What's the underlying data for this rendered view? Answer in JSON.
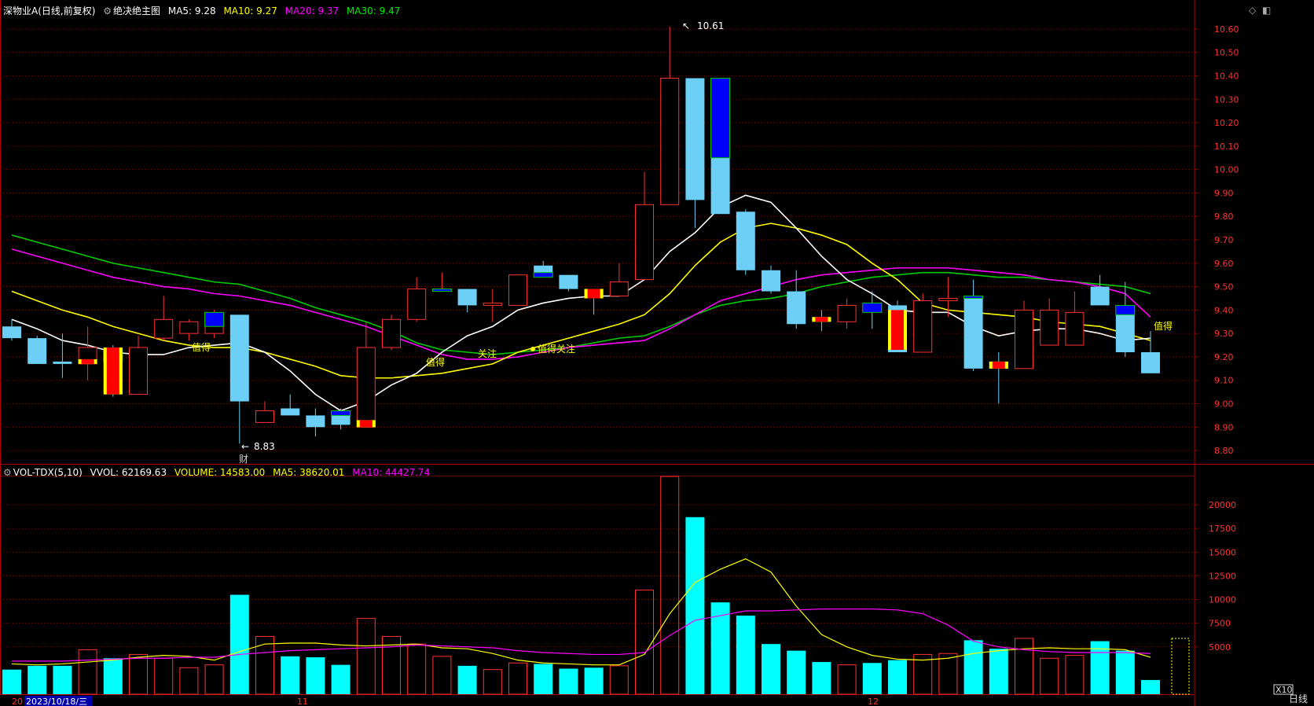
{
  "colors": {
    "up": "#ff3030",
    "down_fill": "#6ccff6",
    "vol_down": "#00ffff",
    "ma5": "#ffffff",
    "ma10": "#ffff00",
    "ma20": "#ff00ff",
    "ma30": "#00cc00",
    "grid": "#8b0000",
    "axis_text": "#ff3333",
    "blue_box": "#0000ff",
    "yellow": "#ffff00"
  },
  "main_header": {
    "stock": "深物业A",
    "mode": "(日线,前复权)",
    "indicator": "绝决绝主图",
    "ma5": "MA5: 9.28",
    "ma10": "MA10: 9.27",
    "ma20": "MA20: 9.37",
    "ma30": "MA30: 9.47"
  },
  "vol_header": {
    "name": "VOL-TDX(5,10)",
    "vvol": "VVOL: 62169.63",
    "volume": "VOLUME: 14583.00",
    "ma5": "MA5: 38620.01",
    "ma10": "MA10: 44427.74"
  },
  "price_axis": {
    "ticks": [
      "10.60",
      "10.50",
      "10.40",
      "10.30",
      "10.20",
      "10.10",
      "10.00",
      "9.90",
      "9.80",
      "9.70",
      "9.60",
      "9.50",
      "9.40",
      "9.30",
      "9.20",
      "9.10",
      "9.00",
      "8.90",
      "8.80"
    ]
  },
  "volume_axis": {
    "ticks": [
      "20000",
      "17500",
      "15000",
      "12500",
      "10000",
      "7500",
      "5000"
    ],
    "unit": "X10"
  },
  "date_axis": {
    "left_stub": "20",
    "selected": "2023/10/18/三",
    "month_labels": [
      "11",
      "12"
    ]
  },
  "annotations": {
    "high": "10.61",
    "low": "8.83",
    "cai": "财",
    "labels": [
      "值得",
      "值得",
      "关注",
      "值得关注",
      "值得"
    ]
  },
  "period": "日线",
  "chart_data": {
    "type": "candlestick",
    "ylim": [
      8.75,
      10.65
    ],
    "volume_ylim": [
      0,
      23000
    ],
    "candles": [
      {
        "o": 9.33,
        "h": 9.36,
        "l": 9.27,
        "c": 9.28,
        "v": 2600
      },
      {
        "o": 9.28,
        "h": 9.29,
        "l": 9.17,
        "c": 9.17,
        "v": 3000
      },
      {
        "o": 9.18,
        "h": 9.3,
        "l": 9.11,
        "c": 9.17,
        "v": 3000
      },
      {
        "o": 9.17,
        "h": 9.33,
        "l": 9.1,
        "c": 9.24,
        "v": 4700
      },
      {
        "o": 9.24,
        "h": 9.25,
        "l": 9.03,
        "c": 9.04,
        "v": 3800
      },
      {
        "o": 9.04,
        "h": 9.29,
        "l": 9.04,
        "c": 9.24,
        "v": 4200
      },
      {
        "o": 9.28,
        "h": 9.46,
        "l": 9.27,
        "c": 9.36,
        "v": 3800
      },
      {
        "o": 9.3,
        "h": 9.36,
        "l": 9.27,
        "c": 9.35,
        "v": 2800
      },
      {
        "o": 9.3,
        "h": 9.4,
        "l": 9.28,
        "c": 9.38,
        "v": 3100
      },
      {
        "o": 9.38,
        "h": 9.38,
        "l": 8.83,
        "c": 9.01,
        "v": 10500
      },
      {
        "o": 8.92,
        "h": 9.01,
        "l": 8.92,
        "c": 8.97,
        "v": 6100
      },
      {
        "o": 8.98,
        "h": 9.04,
        "l": 8.95,
        "c": 8.95,
        "v": 4000
      },
      {
        "o": 8.95,
        "h": 8.98,
        "l": 8.86,
        "c": 8.9,
        "v": 3900
      },
      {
        "o": 8.97,
        "h": 8.98,
        "l": 8.89,
        "c": 8.91,
        "v": 3100
      },
      {
        "o": 8.9,
        "h": 9.35,
        "l": 8.9,
        "c": 9.24,
        "v": 8000
      },
      {
        "o": 9.24,
        "h": 9.38,
        "l": 9.23,
        "c": 9.36,
        "v": 6100
      },
      {
        "o": 9.36,
        "h": 9.54,
        "l": 9.35,
        "c": 9.49,
        "v": 5300
      },
      {
        "o": 9.48,
        "h": 9.56,
        "l": 9.48,
        "c": 9.49,
        "v": 4000
      },
      {
        "o": 9.49,
        "h": 9.49,
        "l": 9.39,
        "c": 9.42,
        "v": 3000
      },
      {
        "o": 9.42,
        "h": 9.49,
        "l": 9.35,
        "c": 9.43,
        "v": 2600
      },
      {
        "o": 9.42,
        "h": 9.55,
        "l": 9.42,
        "c": 9.55,
        "v": 3300
      },
      {
        "o": 9.59,
        "h": 9.61,
        "l": 9.54,
        "c": 9.56,
        "v": 3200
      },
      {
        "o": 9.55,
        "h": 9.55,
        "l": 9.48,
        "c": 9.49,
        "v": 2700
      },
      {
        "o": 9.49,
        "h": 9.49,
        "l": 9.38,
        "c": 9.46,
        "v": 2800
      },
      {
        "o": 9.46,
        "h": 9.6,
        "l": 9.46,
        "c": 9.52,
        "v": 3000
      },
      {
        "o": 9.53,
        "h": 9.99,
        "l": 9.53,
        "c": 9.85,
        "v": 11000
      },
      {
        "o": 9.85,
        "h": 10.61,
        "l": 9.85,
        "c": 10.39,
        "v": 23000
      },
      {
        "o": 10.39,
        "h": 10.39,
        "l": 9.75,
        "c": 9.87,
        "v": 18700
      },
      {
        "o": 10.39,
        "h": 10.39,
        "l": 9.81,
        "c": 9.81,
        "v": 9700
      },
      {
        "o": 9.82,
        "h": 9.83,
        "l": 9.55,
        "c": 9.57,
        "v": 8300
      },
      {
        "o": 9.57,
        "h": 9.59,
        "l": 9.47,
        "c": 9.48,
        "v": 5300
      },
      {
        "o": 9.48,
        "h": 9.57,
        "l": 9.32,
        "c": 9.34,
        "v": 4600
      },
      {
        "o": 9.37,
        "h": 9.4,
        "l": 9.31,
        "c": 9.35,
        "v": 3400
      },
      {
        "o": 9.35,
        "h": 9.45,
        "l": 9.32,
        "c": 9.42,
        "v": 3100
      },
      {
        "o": 9.43,
        "h": 9.48,
        "l": 9.32,
        "c": 9.39,
        "v": 3300
      },
      {
        "o": 9.42,
        "h": 9.44,
        "l": 9.22,
        "c": 9.22,
        "v": 3600
      },
      {
        "o": 9.22,
        "h": 9.47,
        "l": 9.22,
        "c": 9.44,
        "v": 4200
      },
      {
        "o": 9.44,
        "h": 9.54,
        "l": 9.37,
        "c": 9.45,
        "v": 4300
      },
      {
        "o": 9.46,
        "h": 9.53,
        "l": 9.14,
        "c": 9.15,
        "v": 5700
      },
      {
        "o": 9.18,
        "h": 9.22,
        "l": 9.0,
        "c": 9.15,
        "v": 4800
      },
      {
        "o": 9.15,
        "h": 9.44,
        "l": 9.15,
        "c": 9.4,
        "v": 5900
      },
      {
        "o": 9.25,
        "h": 9.45,
        "l": 9.25,
        "c": 9.4,
        "v": 3800
      },
      {
        "o": 9.25,
        "h": 9.48,
        "l": 9.25,
        "c": 9.39,
        "v": 4100
      },
      {
        "o": 9.5,
        "h": 9.55,
        "l": 9.42,
        "c": 9.42,
        "v": 5600
      },
      {
        "o": 9.42,
        "h": 9.52,
        "l": 9.2,
        "c": 9.22,
        "v": 4600
      },
      {
        "o": 9.22,
        "h": 9.31,
        "l": 9.13,
        "c": 9.13,
        "v": 1500
      }
    ],
    "ma5": [
      9.36,
      9.32,
      9.27,
      9.25,
      9.22,
      9.21,
      9.21,
      9.24,
      9.25,
      9.26,
      9.22,
      9.14,
      9.04,
      8.97,
      9.01,
      9.08,
      9.13,
      9.22,
      9.29,
      9.33,
      9.4,
      9.43,
      9.45,
      9.46,
      9.46,
      9.53,
      9.65,
      9.73,
      9.84,
      9.89,
      9.86,
      9.75,
      9.63,
      9.53,
      9.47,
      9.4,
      9.39,
      9.39,
      9.33,
      9.29,
      9.31,
      9.32,
      9.32,
      9.3,
      9.27,
      9.28
    ],
    "ma10": [
      9.48,
      9.44,
      9.4,
      9.37,
      9.33,
      9.3,
      9.27,
      9.25,
      9.24,
      9.24,
      9.22,
      9.19,
      9.16,
      9.12,
      9.11,
      9.11,
      9.12,
      9.13,
      9.15,
      9.17,
      9.22,
      9.25,
      9.28,
      9.31,
      9.34,
      9.38,
      9.47,
      9.59,
      9.69,
      9.75,
      9.77,
      9.75,
      9.72,
      9.68,
      9.6,
      9.53,
      9.43,
      9.4,
      9.39,
      9.38,
      9.37,
      9.35,
      9.34,
      9.33,
      9.3,
      9.27
    ],
    "ma20": [
      9.66,
      9.63,
      9.6,
      9.57,
      9.54,
      9.52,
      9.5,
      9.49,
      9.47,
      9.46,
      9.44,
      9.42,
      9.39,
      9.36,
      9.33,
      9.29,
      9.25,
      9.21,
      9.19,
      9.19,
      9.2,
      9.22,
      9.24,
      9.25,
      9.26,
      9.27,
      9.32,
      9.38,
      9.44,
      9.47,
      9.5,
      9.53,
      9.55,
      9.56,
      9.57,
      9.58,
      9.58,
      9.58,
      9.57,
      9.56,
      9.55,
      9.53,
      9.52,
      9.5,
      9.47,
      9.37
    ],
    "ma30": [
      9.72,
      9.69,
      9.66,
      9.63,
      9.6,
      9.58,
      9.56,
      9.54,
      9.52,
      9.51,
      9.48,
      9.45,
      9.41,
      9.38,
      9.35,
      9.31,
      9.26,
      9.23,
      9.22,
      9.21,
      9.22,
      9.23,
      9.24,
      9.26,
      9.28,
      9.29,
      9.33,
      9.38,
      9.42,
      9.44,
      9.45,
      9.47,
      9.5,
      9.52,
      9.54,
      9.55,
      9.56,
      9.56,
      9.55,
      9.54,
      9.54,
      9.53,
      9.52,
      9.51,
      9.5,
      9.47
    ],
    "vol_ma5": [
      3200,
      3100,
      3200,
      3400,
      3600,
      3900,
      4100,
      4000,
      3600,
      4500,
      5300,
      5400,
      5400,
      5200,
      5100,
      5200,
      5300,
      4900,
      4800,
      4300,
      3600,
      3300,
      3200,
      3100,
      3100,
      4200,
      8500,
      11800,
      13200,
      14300,
      12900,
      9300,
      6300,
      5000,
      4100,
      3700,
      3600,
      3800,
      4300,
      4600,
      4800,
      4900,
      4800,
      4800,
      4700,
      3900
    ],
    "vol_ma10": [
      3500,
      3500,
      3500,
      3600,
      3700,
      3800,
      3800,
      3900,
      3900,
      4200,
      4400,
      4600,
      4700,
      4800,
      4900,
      5000,
      5200,
      5100,
      5000,
      4900,
      4600,
      4400,
      4300,
      4200,
      4200,
      4400,
      6200,
      7800,
      8300,
      8800,
      8800,
      8900,
      9000,
      9000,
      9000,
      8900,
      8500,
      7300,
      5600,
      5000,
      4700,
      4500,
      4400,
      4400,
      4400,
      4300
    ]
  }
}
